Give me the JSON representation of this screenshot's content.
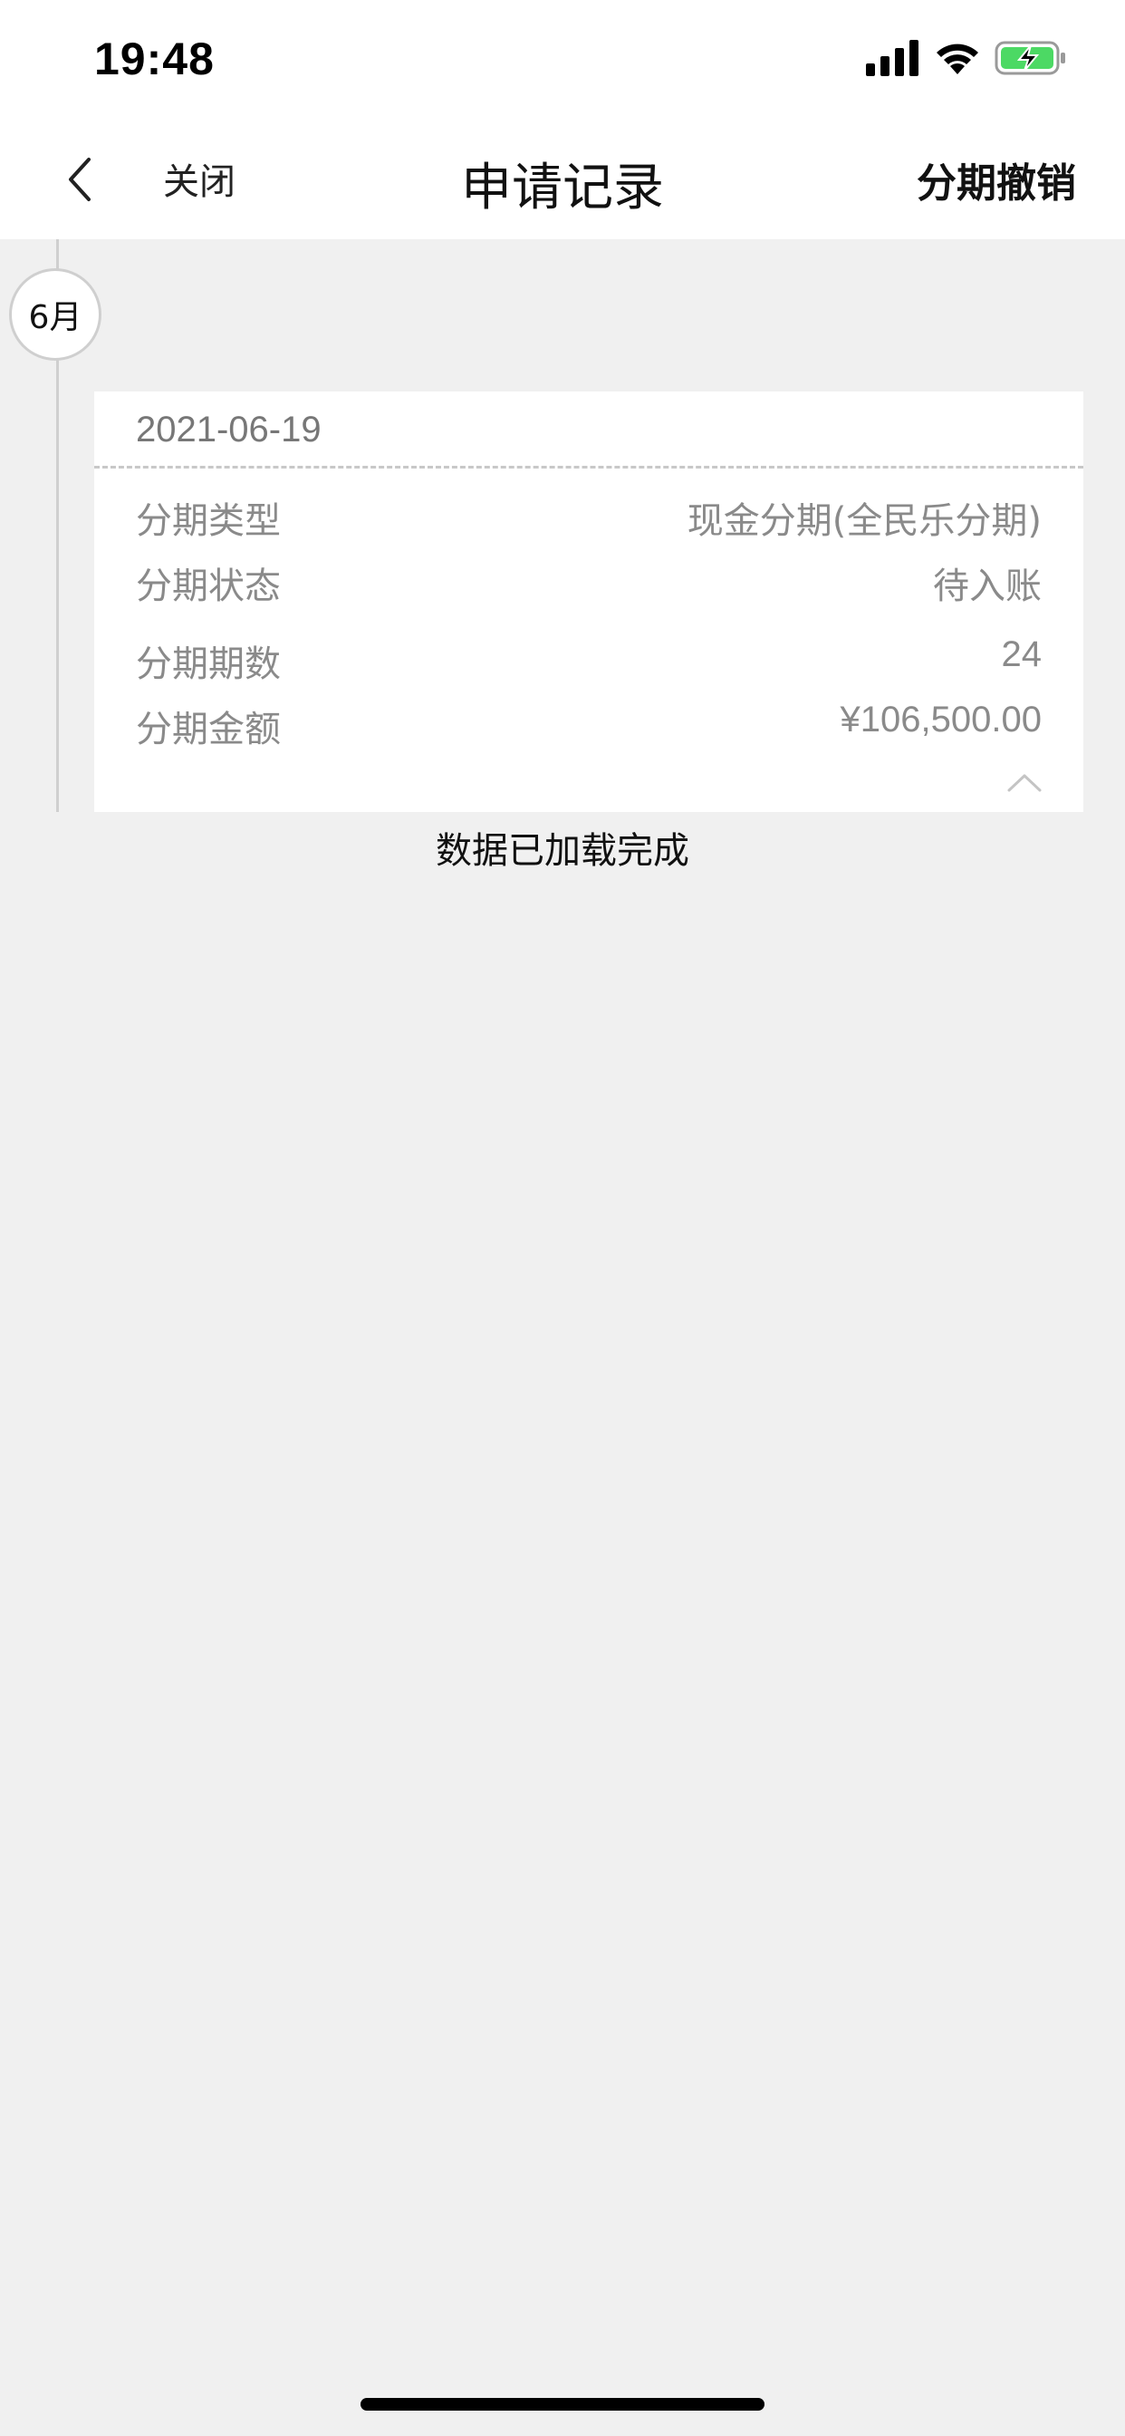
{
  "status_bar": {
    "time": "19:48",
    "icons": [
      "signal-icon",
      "wifi-icon",
      "battery-charging-icon"
    ],
    "battery_color": "#4cd964"
  },
  "nav": {
    "back_icon": "chevron-left-icon",
    "close_label": "关闭",
    "title": "申请记录",
    "right_action_label": "分期撤销"
  },
  "timeline": {
    "month_label": "6月"
  },
  "record": {
    "date": "2021-06-19",
    "rows": [
      {
        "label": "分期类型",
        "value": "现金分期(全民乐分期)"
      },
      {
        "label": "分期状态",
        "value": "待入账"
      },
      {
        "label": "分期期数",
        "value": "24"
      },
      {
        "label": "分期金额",
        "value": "¥106,500.00"
      }
    ],
    "collapse_icon": "chevron-up-icon"
  },
  "footer": {
    "load_status": "数据已加载完成"
  }
}
